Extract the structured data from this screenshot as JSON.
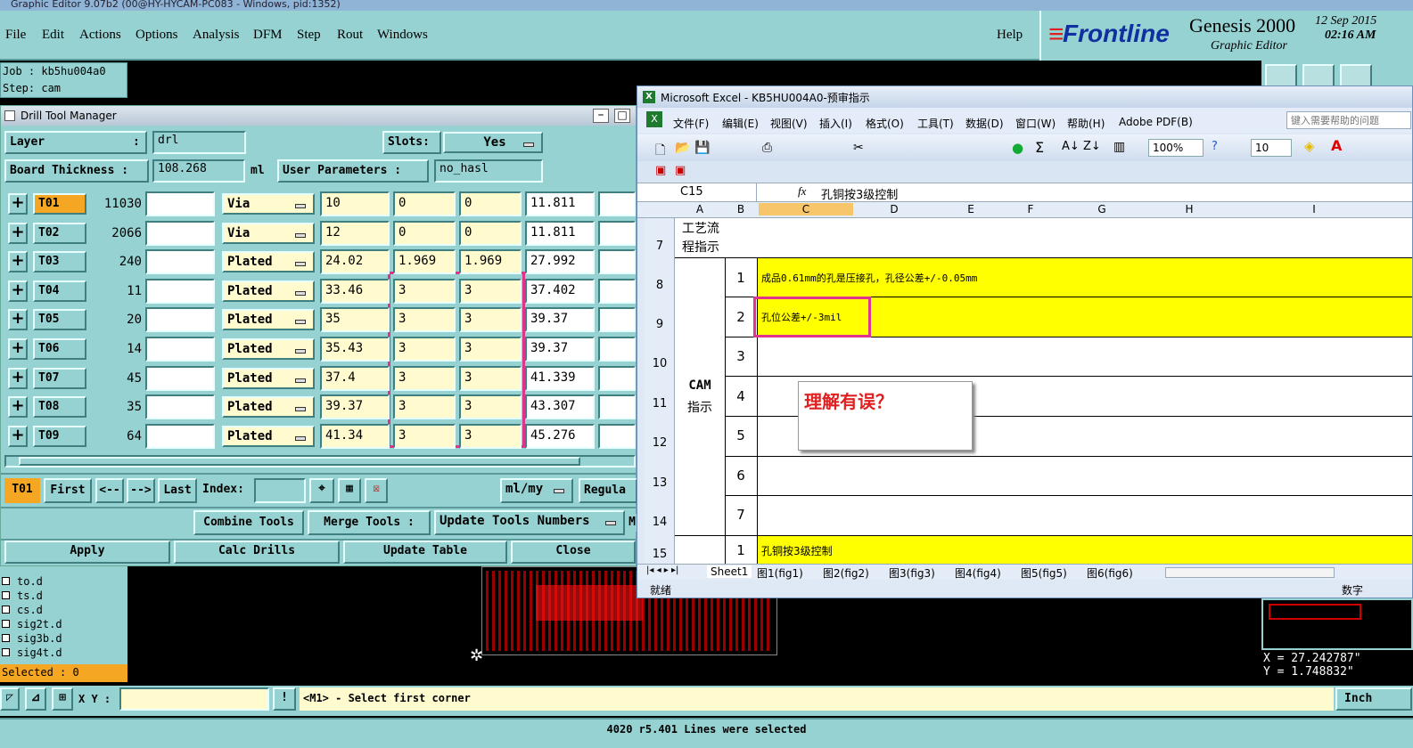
{
  "app": {
    "title": "Graphic Editor 9.07b2 (00@HY-HYCAM-PC083 - Windows, pid:1352)"
  },
  "menu": [
    "File",
    "Edit",
    "Actions",
    "Options",
    "Analysis",
    "DFM",
    "Step",
    "Rout",
    "Windows"
  ],
  "help": "Help",
  "brand": {
    "logo": "Frontline",
    "product": "Genesis 2000",
    "subtitle": "Graphic Editor",
    "date": "12 Sep 2015",
    "time": "02:16 AM"
  },
  "job": {
    "job_line": "Job : kb5hu004a0",
    "step_line": "Step: cam"
  },
  "dtm": {
    "title": "Drill Tool Manager",
    "layer_label": "Layer",
    "layer_sep": ":",
    "layer_value": "drl",
    "slots_label": "Slots:",
    "slots_value": "Yes",
    "thick_label": "Board Thickness :",
    "thick_value": "108.268",
    "thick_unit": "ml",
    "user_params_label": "User Parameters :",
    "user_params_value": "no_hasl",
    "rows": [
      {
        "code": "T01",
        "count": "11030",
        "type": "Via",
        "size": "10",
        "tp": "0",
        "tm": "0",
        "fin": "11.811"
      },
      {
        "code": "T02",
        "count": "2066",
        "type": "Via",
        "size": "12",
        "tp": "0",
        "tm": "0",
        "fin": "11.811"
      },
      {
        "code": "T03",
        "count": "240",
        "type": "Plated",
        "size": "24.02",
        "tp": "1.969",
        "tm": "1.969",
        "fin": "27.992"
      },
      {
        "code": "T04",
        "count": "11",
        "type": "Plated",
        "size": "33.46",
        "tp": "3",
        "tm": "3",
        "fin": "37.402"
      },
      {
        "code": "T05",
        "count": "20",
        "type": "Plated",
        "size": "35",
        "tp": "3",
        "tm": "3",
        "fin": "39.37"
      },
      {
        "code": "T06",
        "count": "14",
        "type": "Plated",
        "size": "35.43",
        "tp": "3",
        "tm": "3",
        "fin": "39.37"
      },
      {
        "code": "T07",
        "count": "45",
        "type": "Plated",
        "size": "37.4",
        "tp": "3",
        "tm": "3",
        "fin": "41.339"
      },
      {
        "code": "T08",
        "count": "35",
        "type": "Plated",
        "size": "39.37",
        "tp": "3",
        "tm": "3",
        "fin": "43.307"
      },
      {
        "code": "T09",
        "count": "64",
        "type": "Plated",
        "size": "41.34",
        "tp": "3",
        "tm": "3",
        "fin": "45.276"
      }
    ],
    "nav": {
      "current": "T01",
      "first": "First",
      "prev": "<--",
      "next": "-->",
      "last": "Last",
      "index_label": "Index:",
      "units": "ml/my",
      "regular": "Regula"
    },
    "tools": {
      "combine": "Combine Tools",
      "merge": "Merge Tools :",
      "update_numbers": "Update Tools Numbers",
      "extra": "M"
    },
    "actions": {
      "apply": "Apply",
      "calc": "Calc Drills",
      "update": "Update Table",
      "close": "Close"
    }
  },
  "layers": [
    "to.d",
    "ts.d",
    "cs.d",
    "sig2t.d",
    "sig3b.d",
    "sig4t.d"
  ],
  "selected": "Selected : 0",
  "excel": {
    "title": "Microsoft Excel - KB5HU004A0-预审指示",
    "menu": [
      "文件(F)",
      "编辑(E)",
      "视图(V)",
      "插入(I)",
      "格式(O)",
      "工具(T)",
      "数据(D)",
      "窗口(W)",
      "帮助(H)",
      "Adobe PDF(B)"
    ],
    "help_placeholder": "键入需要帮助的问题",
    "zoom": "100%",
    "font_size": "10",
    "cell_ref": "C15",
    "fx": "fx",
    "formula": "孔铜按3级控制",
    "cols": [
      "A",
      "B",
      "C",
      "D",
      "E",
      "F",
      "G",
      "H",
      "I"
    ],
    "row_nums": [
      "7",
      "8",
      "9",
      "10",
      "11",
      "12",
      "13",
      "14",
      "15"
    ],
    "a7": "工艺流程指示",
    "a_cam_1": "CAM",
    "a_cam_2": "指示",
    "b": [
      "1",
      "2",
      "3",
      "4",
      "5",
      "6",
      "7",
      "1"
    ],
    "c8": "成品0.61mm的孔是压接孔，孔径公差+/-0.05mm",
    "c9": "孔位公差+/-3mil",
    "c15": "孔铜按3级控制",
    "comment": "理解有误？",
    "sheets": [
      "Sheet1",
      "图1(fig1)",
      "图2(fig2)",
      "图3(fig3)",
      "图4(fig4)",
      "图5(fig5)",
      "图6(fig6)"
    ],
    "status": "就绪",
    "status_right": "数字"
  },
  "coords": {
    "x": "X = 27.242787\"",
    "y": "Y = 1.748832\""
  },
  "xy_label": "X Y :",
  "prompt": "<M1> - Select first corner",
  "units": "Inch",
  "status": "4020 r5.401 Lines were selected",
  "colors": {
    "panel": "#96d2d2",
    "highlight": "#e0338c",
    "excel_yellow": "#ffff00"
  }
}
